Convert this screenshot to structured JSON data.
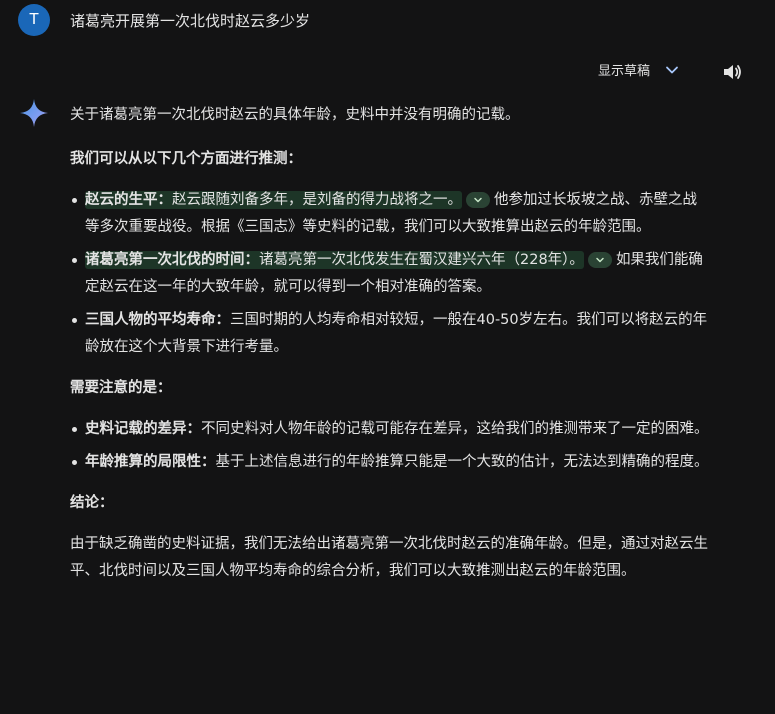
{
  "user": {
    "avatar_letter": "T",
    "query": "诸葛亮开展第一次北伐时赵云多少岁"
  },
  "toolbar": {
    "drafts_label": "显示草稿"
  },
  "response": {
    "intro": "关于诸葛亮第一次北伐时赵云的具体年龄，史料中并没有明确的记载。",
    "heading1": "我们可以从以下几个方面进行推测：",
    "items1": [
      {
        "label": "赵云的生平：",
        "highlight": "赵云跟随刘备多年，是刘备的得力战将之一。",
        "rest": "他参加过长坂坡之战、赤壁之战等多次重要战役。根据《三国志》等史料的记载，我们可以大致推算出赵云的年龄范围。"
      },
      {
        "label": "诸葛亮第一次北伐的时间：",
        "highlight": "诸葛亮第一次北伐发生在蜀汉建兴六年（228年）。",
        "rest": "如果我们能确定赵云在这一年的大致年龄，就可以得到一个相对准确的答案。"
      },
      {
        "label": "三国人物的平均寿命：",
        "text": "三国时期的人均寿命相对较短，一般在40-50岁左右。我们可以将赵云的年龄放在这个大背景下进行考量。"
      }
    ],
    "heading2": "需要注意的是：",
    "items2": [
      {
        "label": "史料记载的差异：",
        "text": "不同史料对人物年龄的记载可能存在差异，这给我们的推测带来了一定的困难。"
      },
      {
        "label": "年龄推算的局限性：",
        "text": "基于上述信息进行的年龄推算只能是一个大致的估计，无法达到精确的程度。"
      }
    ],
    "heading3": "结论：",
    "conclusion": "由于缺乏确凿的史料证据，我们无法给出诸葛亮第一次北伐时赵云的准确年龄。但是，通过对赵云生平、北伐时间以及三国人物平均寿命的综合分析，我们可以大致推测出赵云的年龄范围。"
  },
  "colors": {
    "background": "#131314",
    "avatar": "#1a67b8",
    "highlight": "#1d3527",
    "text": "#e3e3e3"
  },
  "icons": {
    "drafts_toggle": "chevron-down-icon",
    "read_aloud": "speaker-icon",
    "assistant": "sparkle-icon",
    "source_chip": "chevron-down-icon"
  }
}
